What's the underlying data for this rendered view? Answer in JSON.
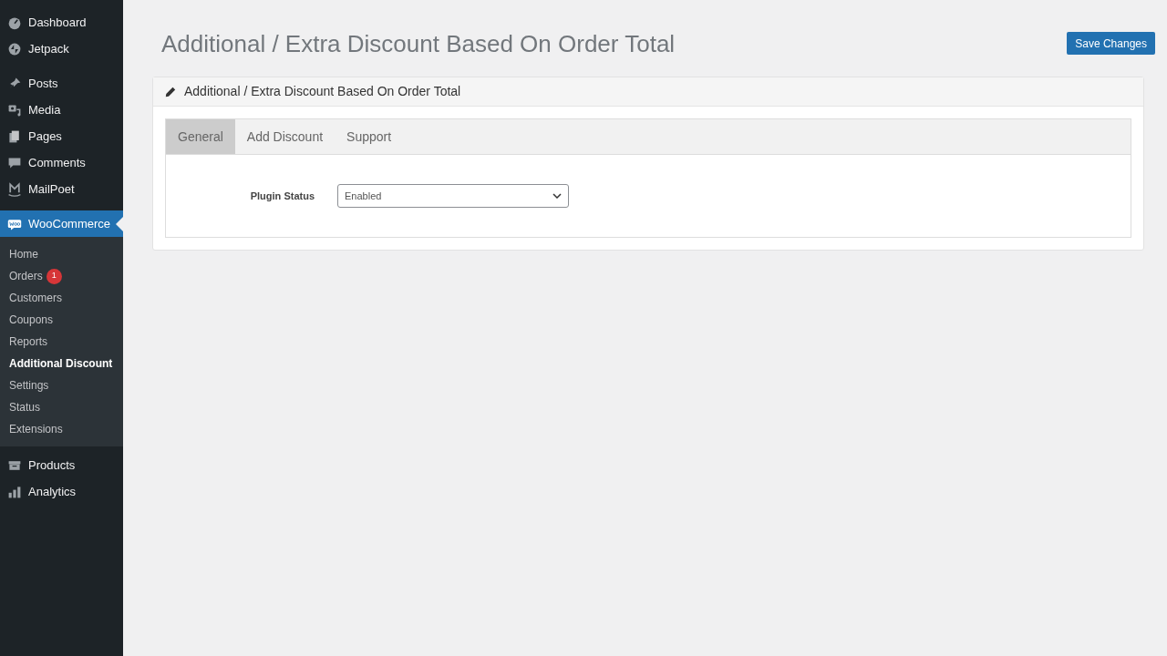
{
  "sidebar": {
    "menu": [
      {
        "label": "Dashboard",
        "selected": false
      },
      {
        "label": "Jetpack",
        "selected": false
      },
      {
        "label": "Posts",
        "selected": false
      },
      {
        "label": "Media",
        "selected": false
      },
      {
        "label": "Pages",
        "selected": false
      },
      {
        "label": "Comments",
        "selected": false
      },
      {
        "label": "MailPoet",
        "selected": false
      },
      {
        "label": "WooCommerce",
        "selected": true,
        "children": [
          {
            "label": "Home",
            "selected": false
          },
          {
            "label": "Orders",
            "selected": false,
            "badge": "1"
          },
          {
            "label": "Customers",
            "selected": false
          },
          {
            "label": "Coupons",
            "selected": false
          },
          {
            "label": "Reports",
            "selected": false
          },
          {
            "label": "Additional Discount",
            "selected": true
          },
          {
            "label": "Settings",
            "selected": false
          },
          {
            "label": "Status",
            "selected": false
          },
          {
            "label": "Extensions",
            "selected": false
          }
        ]
      },
      {
        "label": "Products",
        "selected": false
      },
      {
        "label": "Analytics",
        "selected": false
      }
    ]
  },
  "page": {
    "title": "Additional / Extra Discount Based On Order Total",
    "save_button": "Save Changes"
  },
  "card": {
    "title": "Additional / Extra Discount Based On Order Total",
    "tabs": [
      {
        "label": "General",
        "selected": true
      },
      {
        "label": "Add Discount",
        "selected": false
      },
      {
        "label": "Support",
        "selected": false
      }
    ],
    "fields": [
      {
        "label": "Plugin Status",
        "value": "Enabled"
      }
    ]
  }
}
